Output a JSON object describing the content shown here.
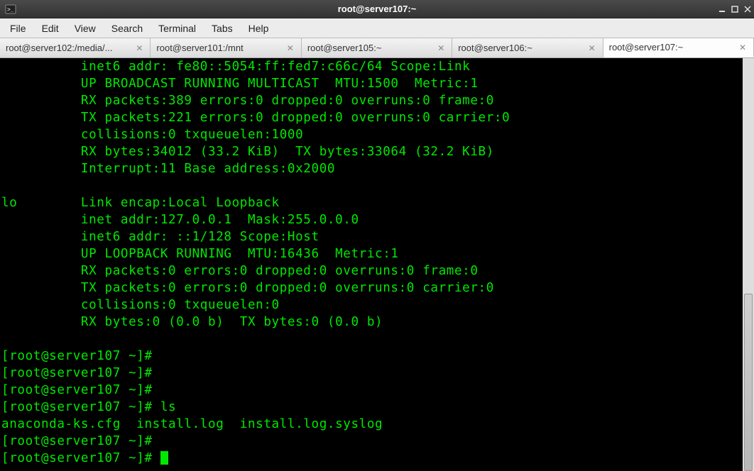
{
  "titlebar": {
    "title": "root@server107:~"
  },
  "menu": {
    "file": "File",
    "edit": "Edit",
    "view": "View",
    "search": "Search",
    "terminal": "Terminal",
    "tabs": "Tabs",
    "help": "Help"
  },
  "tabs": [
    {
      "label": "root@server102:/media/...",
      "active": false
    },
    {
      "label": "root@server101:/mnt",
      "active": false
    },
    {
      "label": "root@server105:~",
      "active": false
    },
    {
      "label": "root@server106:~",
      "active": false
    },
    {
      "label": "root@server107:~",
      "active": true
    }
  ],
  "terminal": {
    "lines": [
      "          inet6 addr: fe80::5054:ff:fed7:c66c/64 Scope:Link",
      "          UP BROADCAST RUNNING MULTICAST  MTU:1500  Metric:1",
      "          RX packets:389 errors:0 dropped:0 overruns:0 frame:0",
      "          TX packets:221 errors:0 dropped:0 overruns:0 carrier:0",
      "          collisions:0 txqueuelen:1000",
      "          RX bytes:34012 (33.2 KiB)  TX bytes:33064 (32.2 KiB)",
      "          Interrupt:11 Base address:0x2000",
      "",
      "lo        Link encap:Local Loopback",
      "          inet addr:127.0.0.1  Mask:255.0.0.0",
      "          inet6 addr: ::1/128 Scope:Host",
      "          UP LOOPBACK RUNNING  MTU:16436  Metric:1",
      "          RX packets:0 errors:0 dropped:0 overruns:0 frame:0",
      "          TX packets:0 errors:0 dropped:0 overruns:0 carrier:0",
      "          collisions:0 txqueuelen:0",
      "          RX bytes:0 (0.0 b)  TX bytes:0 (0.0 b)",
      "",
      "[root@server107 ~]#",
      "[root@server107 ~]#",
      "[root@server107 ~]#",
      "[root@server107 ~]# ls",
      "anaconda-ks.cfg  install.log  install.log.syslog",
      "[root@server107 ~]#"
    ],
    "prompt_final": "[root@server107 ~]# "
  }
}
